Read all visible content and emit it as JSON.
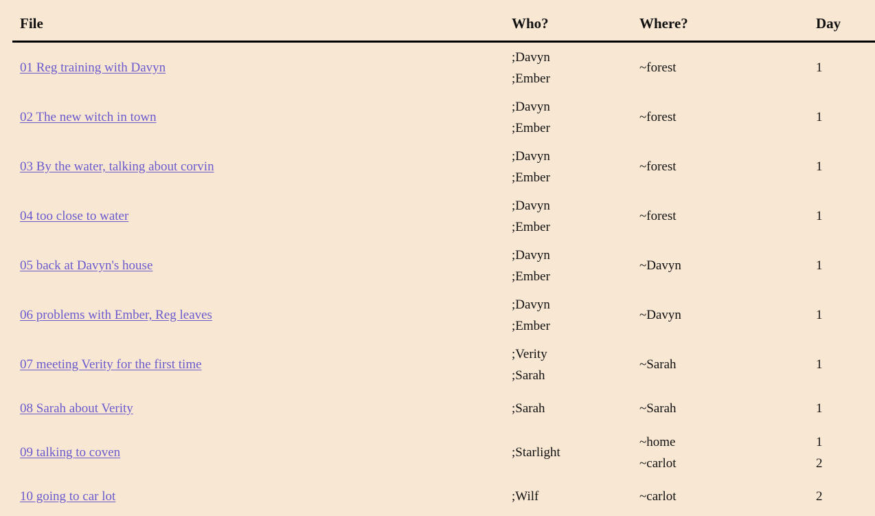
{
  "table": {
    "headers": {
      "file": "File",
      "who": "Who?",
      "where": "Where?",
      "day": "Day"
    },
    "rows": [
      {
        "file": "01 Reg training with Davyn",
        "who": [
          ";Davyn",
          ";Ember"
        ],
        "where": [
          "~forest"
        ],
        "day": [
          "1"
        ]
      },
      {
        "file": "02 The new witch in town",
        "who": [
          ";Davyn",
          ";Ember"
        ],
        "where": [
          "~forest"
        ],
        "day": [
          "1"
        ]
      },
      {
        "file": "03 By the water, talking about corvin",
        "who": [
          ";Davyn",
          ";Ember"
        ],
        "where": [
          "~forest"
        ],
        "day": [
          "1"
        ]
      },
      {
        "file": "04 too close to water",
        "who": [
          ";Davyn",
          ";Ember"
        ],
        "where": [
          "~forest"
        ],
        "day": [
          "1"
        ]
      },
      {
        "file": "05 back at Davyn's house",
        "who": [
          ";Davyn",
          ";Ember"
        ],
        "where": [
          "~Davyn"
        ],
        "day": [
          "1"
        ]
      },
      {
        "file": "06 problems with Ember, Reg leaves",
        "who": [
          ";Davyn",
          ";Ember"
        ],
        "where": [
          "~Davyn"
        ],
        "day": [
          "1"
        ]
      },
      {
        "file": "07 meeting Verity for the first time",
        "who": [
          ";Verity",
          ";Sarah"
        ],
        "where": [
          "~Sarah"
        ],
        "day": [
          "1"
        ]
      },
      {
        "file": "08 Sarah about Verity",
        "who": [
          ";Sarah"
        ],
        "where": [
          "~Sarah"
        ],
        "day": [
          "1"
        ]
      },
      {
        "file": "09 talking to coven",
        "who": [
          ";Starlight"
        ],
        "where": [
          "~home",
          "~carlot"
        ],
        "day": [
          "1",
          "2"
        ]
      },
      {
        "file": "10 going to car lot",
        "who": [
          ";Wilf"
        ],
        "where": [
          "~carlot"
        ],
        "day": [
          "2"
        ]
      }
    ]
  },
  "colors": {
    "background": "#f8e7d3",
    "link": "#6a5acd",
    "text": "#111111",
    "header_rule": "#000000"
  }
}
